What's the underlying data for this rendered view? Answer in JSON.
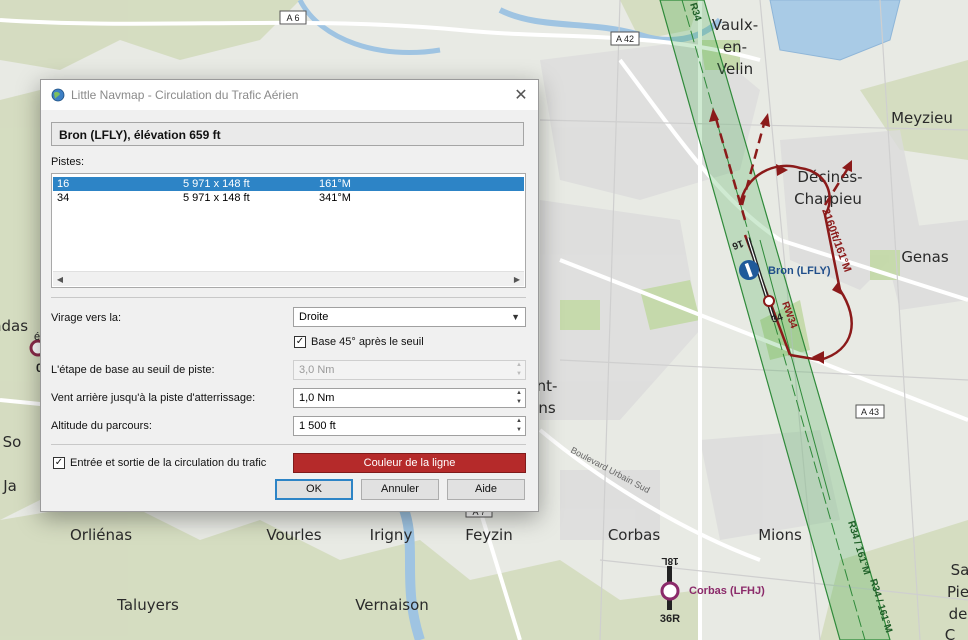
{
  "window": {
    "title": "Little Navmap - Circulation du Trafic Aérien"
  },
  "airport": {
    "header": "Bron (LFLY), élévation 659 ft"
  },
  "runways": {
    "label": "Pistes:",
    "rows": [
      {
        "name": "16",
        "size": "5 971 x 148 ft",
        "heading": "161°M",
        "selected": true
      },
      {
        "name": "34",
        "size": "5 971 x 148 ft",
        "heading": "341°M",
        "selected": false
      }
    ]
  },
  "form": {
    "turn_label": "Virage vers la:",
    "turn_value": "Droite",
    "base45_label": "Base 45° après le seuil",
    "base45_checked": true,
    "base_distance_label": "L'étape de base au seuil de piste:",
    "base_distance_value": "3,0 Nm",
    "downwind_label": "Vent arrière jusqu'à la piste d'atterrissage:",
    "downwind_value": "1,0 Nm",
    "altitude_label": "Altitude du parcours:",
    "altitude_value": "1 500 ft",
    "entry_exit_label": "Entrée et sortie de la circulation du trafic",
    "entry_exit_checked": true,
    "line_color_label": "Couleur de la ligne",
    "line_color": "#b52a2a"
  },
  "buttons": {
    "ok": "OK",
    "cancel": "Annuler",
    "help": "Aide"
  },
  "map": {
    "places": [
      "Vaulx-",
      "en-",
      "Velin",
      "Meyzieu",
      "Décines-",
      "Charpieu",
      "Genas",
      "Mions",
      "Corbas",
      "Feyzin",
      "Irigny",
      "Vourles",
      "Orliénas",
      "Taluyers",
      "Vernaison",
      "ndas",
      "So",
      "Ja",
      "nt-",
      "ns",
      "Sa",
      "Pie",
      "de",
      "C"
    ],
    "roads": [
      "A 6",
      "A 42",
      "A 43",
      "A 7"
    ],
    "street": "Boulevard Urbain Sud",
    "airport_bron": "Bron (LFLY)",
    "airport_corbas": "Corbas (LFHJ)",
    "rwy_16": "16",
    "rwy_34": "34",
    "rwy_18L": "18L",
    "rwy_36R": "36R",
    "pattern_label": "2160ft/161°M",
    "rw_label": "RW34",
    "approach_label": "R34 / 161°M",
    "approach_label2": "R34 / 161°M",
    "top_label": "R34",
    "partial_o": "0",
    "partial_e": "é",
    "partial_t": "T"
  }
}
